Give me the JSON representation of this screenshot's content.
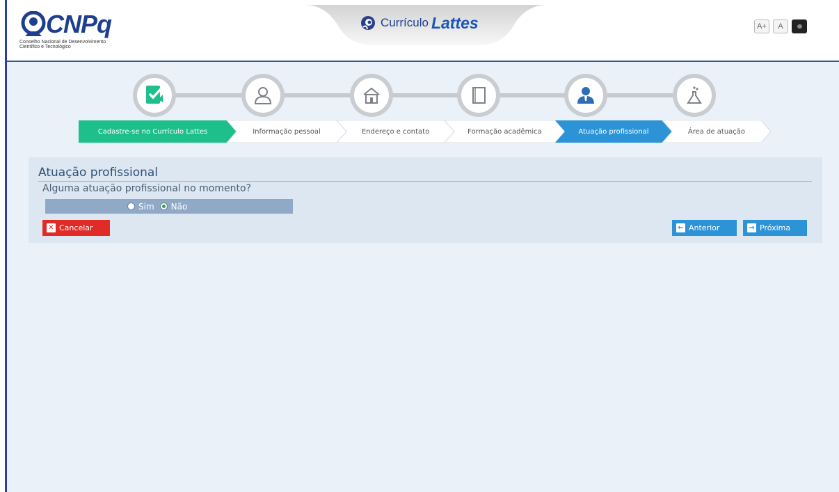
{
  "header": {
    "logo_text": "CNPq",
    "logo_subtitle_line1": "Conselho Nacional de Desenvolvimento",
    "logo_subtitle_line2": "Científico e Tecnológico",
    "app_title_small": "Currículo",
    "app_title_big": "Lattes",
    "font_controls": [
      "A+",
      "A"
    ]
  },
  "steps": [
    {
      "label": "Cadastre-se no Currículo Lattes",
      "icon": "checklist-icon",
      "state": "done"
    },
    {
      "label": "Informação pessoal",
      "icon": "person-icon",
      "state": "pending"
    },
    {
      "label": "Endereço e contato",
      "icon": "house-icon",
      "state": "pending"
    },
    {
      "label": "Formação acadêmica",
      "icon": "book-icon",
      "state": "pending"
    },
    {
      "label": "Atuação profissional",
      "icon": "professional-icon",
      "state": "active"
    },
    {
      "label": "Área de atuação",
      "icon": "flask-icon",
      "state": "pending"
    }
  ],
  "form": {
    "title": "Atuação profissional",
    "question": "Alguma atuação profissional no momento?",
    "options": [
      {
        "label": "Sim",
        "checked": false
      },
      {
        "label": "Não",
        "checked": true
      }
    ],
    "cancel_label": "Cancelar",
    "previous_label": "Anterior",
    "next_label": "Próxima"
  },
  "colors": {
    "done": "#1dbf8a",
    "active": "#2c93d6",
    "cancel": "#e02b26",
    "brand": "#1e3f8f"
  }
}
